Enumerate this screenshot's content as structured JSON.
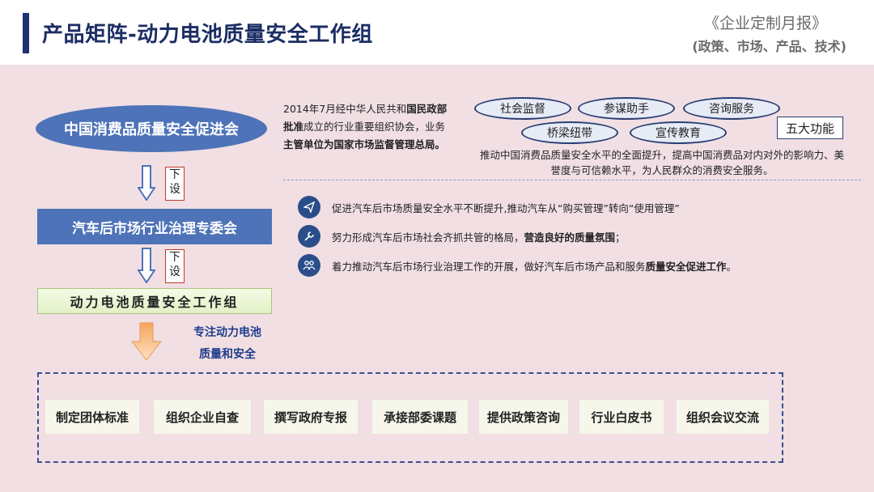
{
  "header": {
    "title": "产品矩阵-动力电池质量安全工作组",
    "report_title": "《企业定制月报》",
    "report_subtitle": "(政策、市场、产品、技术)"
  },
  "org": {
    "top": "中国消费品质量安全促进会",
    "middle": "汽车后市场行业治理专委会",
    "bottom": "动力电池质量安全工作组",
    "sub_label_1": "下设",
    "sub_label_2": "下设",
    "focus_line1": "专注动力电池",
    "focus_line2": "质量和安全"
  },
  "description": {
    "part1": "2014年7月经中华人民共和",
    "part2": "国民政部批准",
    "part3": "成立的行业重要组织协会，业务",
    "part4": "主管单位为国家市场监督管理总局。"
  },
  "functions": {
    "items": [
      "社会监督",
      "参谋助手",
      "咨询服务",
      "桥梁纽带",
      "宣传教育"
    ],
    "label": "五大功能",
    "description": "推动中国消费品质量安全水平的全面提升，提高中国消费品对内对外的影响力、美誉度与可信赖水平，为人民群众的消费安全服务。"
  },
  "bullets": [
    {
      "icon": "paper-plane-icon",
      "text": "促进汽车后市场质量安全水平不断提升,推动汽车从“购买管理”转向“使用管理”",
      "bold": ""
    },
    {
      "icon": "wrench-icon",
      "text": "努力形成汽车后市场社会齐抓共管的格局，",
      "bold": "营造良好的质量氛围",
      "suffix": "；"
    },
    {
      "icon": "people-icon",
      "text": "着力推动汽车后市场行业治理工作的开展，做好汽车后市场产品和服务",
      "bold": "质量安全促进工作",
      "suffix": "。"
    }
  ],
  "tasks": [
    "制定团体标准",
    "组织企业自查",
    "撰写政府专报",
    "承接部委课题",
    "提供政策咨询",
    "行业白皮书",
    "组织会议交流"
  ],
  "colors": {
    "primary": "#1e3473",
    "org_blue": "#4e73b8",
    "background": "#f1dfe3",
    "accent_orange": "#f6a55c"
  }
}
